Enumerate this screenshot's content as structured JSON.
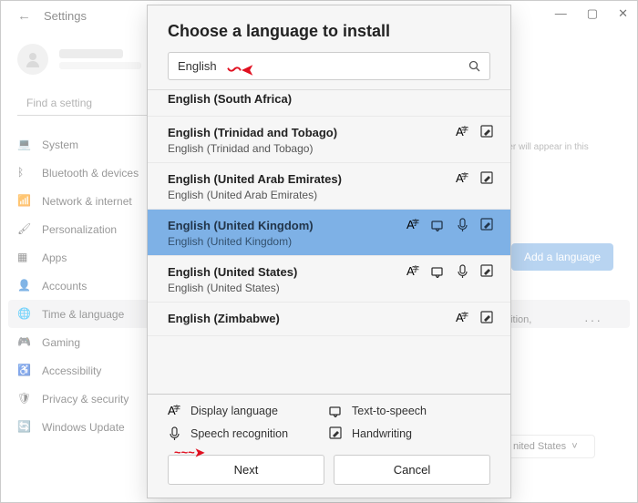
{
  "window": {
    "title": "Settings",
    "search_placeholder": "Find a setting",
    "nav": [
      {
        "label": "System"
      },
      {
        "label": "Bluetooth & devices"
      },
      {
        "label": "Network & internet"
      },
      {
        "label": "Personalization"
      },
      {
        "label": "Apps"
      },
      {
        "label": "Accounts"
      },
      {
        "label": "Time & language"
      },
      {
        "label": "Gaming"
      },
      {
        "label": "Accessibility"
      },
      {
        "label": "Privacy & security"
      },
      {
        "label": "Windows Update"
      }
    ],
    "right": {
      "hint": "rer will appear in this",
      "add_language": "Add a language",
      "partial": "nition,",
      "dropdown": "nited States"
    }
  },
  "dialog": {
    "title": "Choose a language to install",
    "search_value": "English",
    "languages": [
      {
        "main": "English (South Africa)",
        "sub": "",
        "feat": []
      },
      {
        "main": "English (Trinidad and Tobago)",
        "sub": "English (Trinidad and Tobago)",
        "feat": [
          "display",
          "hand"
        ]
      },
      {
        "main": "English (United Arab Emirates)",
        "sub": "English (United Arab Emirates)",
        "feat": [
          "display",
          "hand"
        ]
      },
      {
        "main": "English (United Kingdom)",
        "sub": "English (United Kingdom)",
        "feat": [
          "display",
          "tts",
          "speech",
          "hand"
        ],
        "selected": true
      },
      {
        "main": "English (United States)",
        "sub": "English (United States)",
        "feat": [
          "display",
          "tts",
          "speech",
          "hand"
        ]
      },
      {
        "main": "English (Zimbabwe)",
        "sub": "",
        "feat": [
          "display",
          "hand"
        ]
      }
    ],
    "features": {
      "display": "Display language",
      "tts": "Text-to-speech",
      "speech": "Speech recognition",
      "hand": "Handwriting"
    },
    "buttons": {
      "next": "Next",
      "cancel": "Cancel"
    }
  }
}
